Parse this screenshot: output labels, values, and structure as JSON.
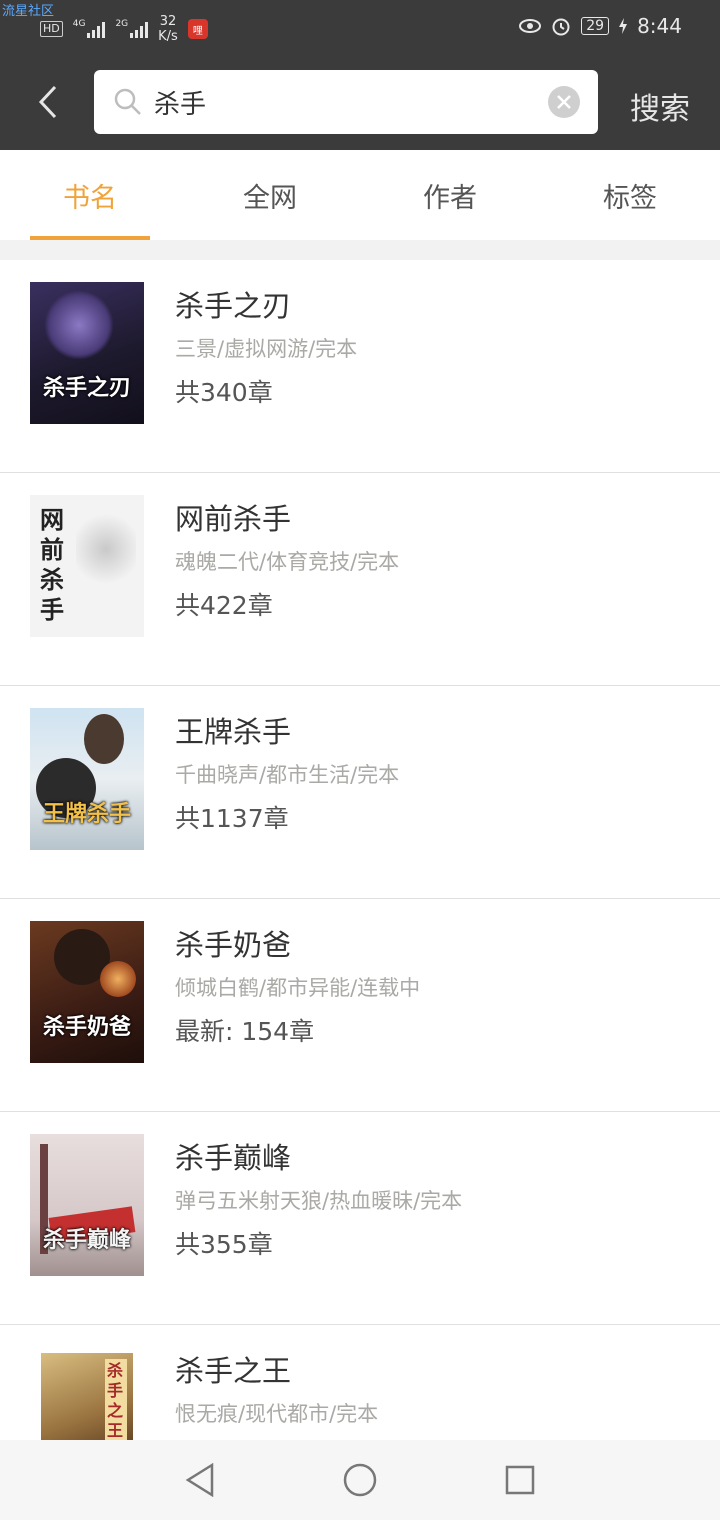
{
  "status": {
    "watermark": "流星社区",
    "hd": "HD",
    "sig1": "4G",
    "sig2": "2G",
    "speed_val": "32",
    "speed_unit": "K/s",
    "app_badge": "哩",
    "battery": "29",
    "time": "8:44"
  },
  "search": {
    "query": "杀手",
    "button": "搜索"
  },
  "tabs": [
    "书名",
    "全网",
    "作者",
    "标签"
  ],
  "books": [
    {
      "title": "杀手之刃",
      "sub": "三景/虚拟网游/完本",
      "chapters": "共340章",
      "cover_text": "杀手之刃",
      "cover_bg": "#2a2540",
      "cover_fg": "#6b4d9a"
    },
    {
      "title": "网前杀手",
      "sub": "魂魄二代/体育竞技/完本",
      "chapters": "共422章",
      "cover_text": "网前杀手",
      "cover_bg": "#f2f2f2",
      "cover_fg": "#9a9a9a"
    },
    {
      "title": "王牌杀手",
      "sub": "千曲晓声/都市生活/完本",
      "chapters": "共1137章",
      "cover_text": "王牌杀手",
      "cover_bg": "#d9e6ee",
      "cover_fg": "#6c8ea2"
    },
    {
      "title": "杀手奶爸",
      "sub": "倾城白鹤/都市异能/连载中",
      "chapters": "最新: 154章",
      "cover_text": "杀手奶爸",
      "cover_bg": "#5a2a1e",
      "cover_fg": "#c7672b"
    },
    {
      "title": "杀手巅峰",
      "sub": "弹弓五米射天狼/热血暖昧/完本",
      "chapters": "共355章",
      "cover_text": "杀手巅峰",
      "cover_bg": "#e5dada",
      "cover_fg": "#c23a3a"
    },
    {
      "title": "杀手之王",
      "sub": "恨无痕/现代都市/完本",
      "chapters": "",
      "cover_text": "杀手之王",
      "cover_bg": "#b99a5c",
      "cover_fg": "#7a4a2a"
    }
  ]
}
